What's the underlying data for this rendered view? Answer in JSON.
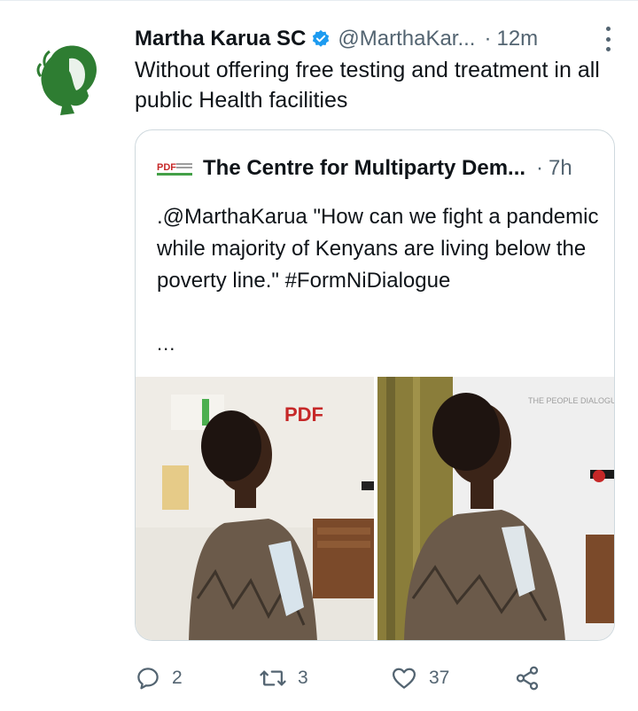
{
  "tweet": {
    "author_name": "Martha Karua SC",
    "handle": "@MarthaKar...",
    "separator": "·",
    "time": "12m",
    "text": "Without offering free testing and treatment in all public Health facilities"
  },
  "quoted": {
    "logo_text": "PDF",
    "author_name": "The Centre for Multiparty Dem...",
    "separator": "·",
    "time": "7h",
    "text": ".@MarthaKarua \"How can we fight a pandemic while majority of Kenyans are living below the poverty line.\" #FormNiDialogue",
    "ellipsis": "...",
    "photo_left_banner": "PDF",
    "photo_right_banner": "THE PEOPLE DIALOGUE FESTIVAL"
  },
  "actions": {
    "reply_count": "2",
    "retweet_count": "3",
    "like_count": "37"
  },
  "colors": {
    "verified": "#1d9bf0",
    "muted": "#536471",
    "avatar_green": "#2e7d32"
  },
  "icons": [
    "verified-badge-icon",
    "more-icon",
    "reply-icon",
    "retweet-icon",
    "like-icon",
    "share-icon"
  ]
}
